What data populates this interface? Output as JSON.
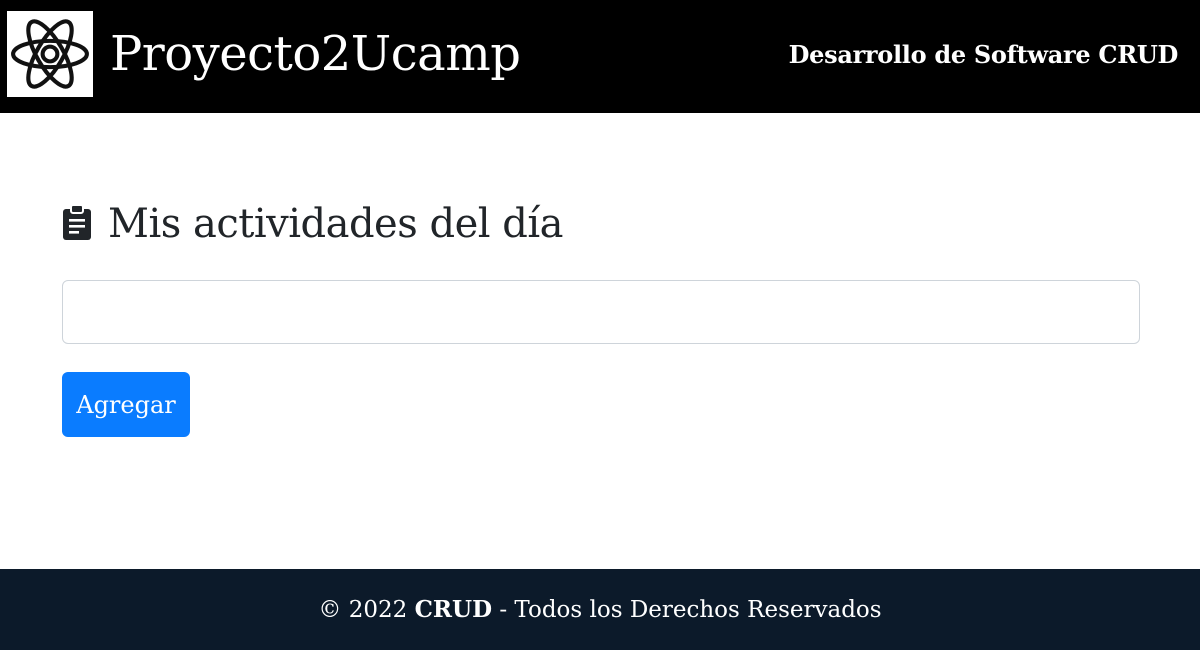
{
  "navbar": {
    "logo_icon": "atom-icon",
    "brand": "Proyecto2Ucamp",
    "tagline": "Desarrollo de Software CRUD"
  },
  "main": {
    "heading_icon": "clipboard-icon",
    "heading": "Mis actividades del día",
    "input": {
      "value": "",
      "placeholder": ""
    },
    "add_button": "Agregar"
  },
  "footer": {
    "copyright_year": "© 2022",
    "brand": "CRUD",
    "rights": "- Todos los Derechos Reservados"
  },
  "colors": {
    "navbar_bg": "#000000",
    "button_bg": "#0a7cff",
    "footer_bg": "#0c1a2a"
  }
}
